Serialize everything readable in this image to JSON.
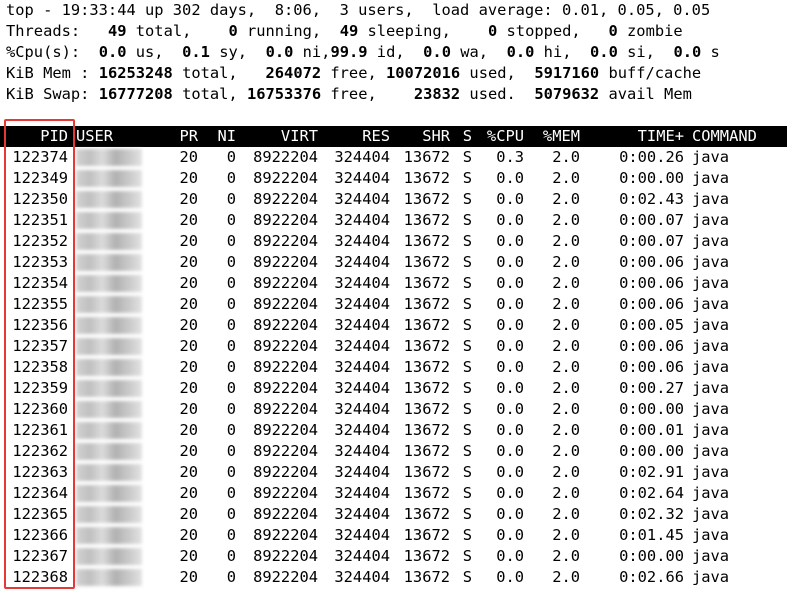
{
  "summary": {
    "line1": "top - 19:33:44 up 302 days,  8:06,  3 users,  load average: 0.01, 0.05, 0.05",
    "threads": {
      "label": "Threads:",
      "total": "49",
      "total_lbl": " total,",
      "running": "0",
      "running_lbl": " running,",
      "sleeping": "49",
      "sleeping_lbl": " sleeping,",
      "stopped": "0",
      "stopped_lbl": " stopped,",
      "zombie": "0",
      "zombie_lbl": " zombie"
    },
    "cpu": {
      "label": "%Cpu(s):",
      "us": "0.0",
      "us_lbl": " us,",
      "sy": "0.1",
      "sy_lbl": " sy,",
      "ni": "0.0",
      "ni_lbl": " ni,",
      "id": "99.9",
      "id_lbl": " id,",
      "wa": "0.0",
      "wa_lbl": " wa,",
      "hi": "0.0",
      "hi_lbl": " hi,",
      "si": "0.0",
      "si_lbl": " si,",
      "st": "0.0",
      "st_lbl": " s"
    },
    "mem": {
      "label": "KiB Mem :",
      "total": "16253248",
      "total_lbl": " total,",
      "free": "264072",
      "free_lbl": " free,",
      "used": "10072016",
      "used_lbl": " used,",
      "buff": "5917160",
      "buff_lbl": " buff/cache"
    },
    "swap": {
      "label": "KiB Swap:",
      "total": "16777208",
      "total_lbl": " total,",
      "free": "16753376",
      "free_lbl": " free,",
      "used": "23832",
      "used_lbl": " used.",
      "avail": "5079632",
      "avail_lbl": " avail Mem"
    }
  },
  "columns": {
    "pid": "PID",
    "user": "USER",
    "pr": "PR",
    "ni": "NI",
    "virt": "VIRT",
    "res": "RES",
    "shr": "SHR",
    "s": "S",
    "cpu": "%CPU",
    "mem": "%MEM",
    "time": "TIME+",
    "command": "COMMAND"
  },
  "processes": [
    {
      "pid": "122374",
      "pr": "20",
      "ni": "0",
      "virt": "8922204",
      "res": "324404",
      "shr": "13672",
      "s": "S",
      "cpu": "0.3",
      "mem": "2.0",
      "time": "0:00.26",
      "command": "java"
    },
    {
      "pid": "122349",
      "pr": "20",
      "ni": "0",
      "virt": "8922204",
      "res": "324404",
      "shr": "13672",
      "s": "S",
      "cpu": "0.0",
      "mem": "2.0",
      "time": "0:00.00",
      "command": "java"
    },
    {
      "pid": "122350",
      "pr": "20",
      "ni": "0",
      "virt": "8922204",
      "res": "324404",
      "shr": "13672",
      "s": "S",
      "cpu": "0.0",
      "mem": "2.0",
      "time": "0:02.43",
      "command": "java"
    },
    {
      "pid": "122351",
      "pr": "20",
      "ni": "0",
      "virt": "8922204",
      "res": "324404",
      "shr": "13672",
      "s": "S",
      "cpu": "0.0",
      "mem": "2.0",
      "time": "0:00.07",
      "command": "java"
    },
    {
      "pid": "122352",
      "pr": "20",
      "ni": "0",
      "virt": "8922204",
      "res": "324404",
      "shr": "13672",
      "s": "S",
      "cpu": "0.0",
      "mem": "2.0",
      "time": "0:00.07",
      "command": "java"
    },
    {
      "pid": "122353",
      "pr": "20",
      "ni": "0",
      "virt": "8922204",
      "res": "324404",
      "shr": "13672",
      "s": "S",
      "cpu": "0.0",
      "mem": "2.0",
      "time": "0:00.06",
      "command": "java"
    },
    {
      "pid": "122354",
      "pr": "20",
      "ni": "0",
      "virt": "8922204",
      "res": "324404",
      "shr": "13672",
      "s": "S",
      "cpu": "0.0",
      "mem": "2.0",
      "time": "0:00.06",
      "command": "java"
    },
    {
      "pid": "122355",
      "pr": "20",
      "ni": "0",
      "virt": "8922204",
      "res": "324404",
      "shr": "13672",
      "s": "S",
      "cpu": "0.0",
      "mem": "2.0",
      "time": "0:00.06",
      "command": "java"
    },
    {
      "pid": "122356",
      "pr": "20",
      "ni": "0",
      "virt": "8922204",
      "res": "324404",
      "shr": "13672",
      "s": "S",
      "cpu": "0.0",
      "mem": "2.0",
      "time": "0:00.05",
      "command": "java"
    },
    {
      "pid": "122357",
      "pr": "20",
      "ni": "0",
      "virt": "8922204",
      "res": "324404",
      "shr": "13672",
      "s": "S",
      "cpu": "0.0",
      "mem": "2.0",
      "time": "0:00.06",
      "command": "java"
    },
    {
      "pid": "122358",
      "pr": "20",
      "ni": "0",
      "virt": "8922204",
      "res": "324404",
      "shr": "13672",
      "s": "S",
      "cpu": "0.0",
      "mem": "2.0",
      "time": "0:00.06",
      "command": "java"
    },
    {
      "pid": "122359",
      "pr": "20",
      "ni": "0",
      "virt": "8922204",
      "res": "324404",
      "shr": "13672",
      "s": "S",
      "cpu": "0.0",
      "mem": "2.0",
      "time": "0:00.27",
      "command": "java"
    },
    {
      "pid": "122360",
      "pr": "20",
      "ni": "0",
      "virt": "8922204",
      "res": "324404",
      "shr": "13672",
      "s": "S",
      "cpu": "0.0",
      "mem": "2.0",
      "time": "0:00.00",
      "command": "java"
    },
    {
      "pid": "122361",
      "pr": "20",
      "ni": "0",
      "virt": "8922204",
      "res": "324404",
      "shr": "13672",
      "s": "S",
      "cpu": "0.0",
      "mem": "2.0",
      "time": "0:00.01",
      "command": "java"
    },
    {
      "pid": "122362",
      "pr": "20",
      "ni": "0",
      "virt": "8922204",
      "res": "324404",
      "shr": "13672",
      "s": "S",
      "cpu": "0.0",
      "mem": "2.0",
      "time": "0:00.00",
      "command": "java"
    },
    {
      "pid": "122363",
      "pr": "20",
      "ni": "0",
      "virt": "8922204",
      "res": "324404",
      "shr": "13672",
      "s": "S",
      "cpu": "0.0",
      "mem": "2.0",
      "time": "0:02.91",
      "command": "java"
    },
    {
      "pid": "122364",
      "pr": "20",
      "ni": "0",
      "virt": "8922204",
      "res": "324404",
      "shr": "13672",
      "s": "S",
      "cpu": "0.0",
      "mem": "2.0",
      "time": "0:02.64",
      "command": "java"
    },
    {
      "pid": "122365",
      "pr": "20",
      "ni": "0",
      "virt": "8922204",
      "res": "324404",
      "shr": "13672",
      "s": "S",
      "cpu": "0.0",
      "mem": "2.0",
      "time": "0:02.32",
      "command": "java"
    },
    {
      "pid": "122366",
      "pr": "20",
      "ni": "0",
      "virt": "8922204",
      "res": "324404",
      "shr": "13672",
      "s": "S",
      "cpu": "0.0",
      "mem": "2.0",
      "time": "0:01.45",
      "command": "java"
    },
    {
      "pid": "122367",
      "pr": "20",
      "ni": "0",
      "virt": "8922204",
      "res": "324404",
      "shr": "13672",
      "s": "S",
      "cpu": "0.0",
      "mem": "2.0",
      "time": "0:00.00",
      "command": "java"
    },
    {
      "pid": "122368",
      "pr": "20",
      "ni": "0",
      "virt": "8922204",
      "res": "324404",
      "shr": "13672",
      "s": "S",
      "cpu": "0.0",
      "mem": "2.0",
      "time": "0:02.66",
      "command": "java"
    }
  ],
  "colors": {
    "highlight_box": "#e53935",
    "background": "#ffffff",
    "header_bg": "#000000"
  }
}
